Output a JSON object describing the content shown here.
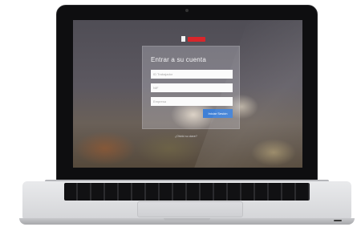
{
  "login": {
    "title": "Entrar a su cuenta",
    "fields": [
      {
        "placeholder": "ID Trabajador"
      },
      {
        "placeholder": "NIF"
      },
      {
        "placeholder": "Empresa"
      }
    ],
    "submit_label": "Iniciar Sesión",
    "footer_link": "¿Olvidó su clave?"
  },
  "brand": {
    "logo_color": "#d9262b"
  },
  "colors": {
    "button": "#3f80d6",
    "laptop_bezel": "#0e0e10",
    "laptop_body": "#e3e4e6"
  }
}
